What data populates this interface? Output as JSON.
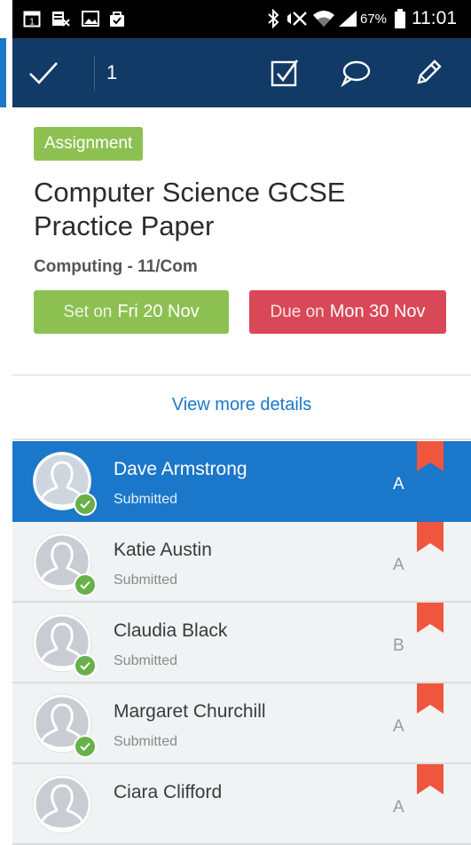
{
  "status_bar": {
    "battery": "67%",
    "time": "11:01"
  },
  "app_bar": {
    "selected_count": "1"
  },
  "assignment": {
    "badge": "Assignment",
    "title": "Computer Science GCSE Practice Paper",
    "subject": "Computing - 11/Com",
    "set_label": "Set on",
    "set_date": "Fri 20 Nov",
    "due_label": "Due on",
    "due_date": "Mon 30 Nov",
    "more_details": "View more details"
  },
  "students": [
    {
      "name": "Dave Armstrong",
      "status": "Submitted",
      "grade": "A",
      "selected": true
    },
    {
      "name": "Katie Austin",
      "status": "Submitted",
      "grade": "A",
      "selected": false
    },
    {
      "name": "Claudia Black",
      "status": "Submitted",
      "grade": "B",
      "selected": false
    },
    {
      "name": "Margaret Churchill",
      "status": "Submitted",
      "grade": "A",
      "selected": false
    },
    {
      "name": "Ciara Clifford",
      "status": "",
      "grade": "A",
      "selected": false
    }
  ],
  "colors": {
    "app_bar": "#123a66",
    "accent_blue": "#1a77c9",
    "green": "#8cc152",
    "red": "#d94856",
    "flag": "#f0553e"
  },
  "icons": {
    "done": "checkmark-icon",
    "mark": "checkbox-icon",
    "comment": "comment-bubble-icon",
    "edit": "pencil-icon"
  }
}
